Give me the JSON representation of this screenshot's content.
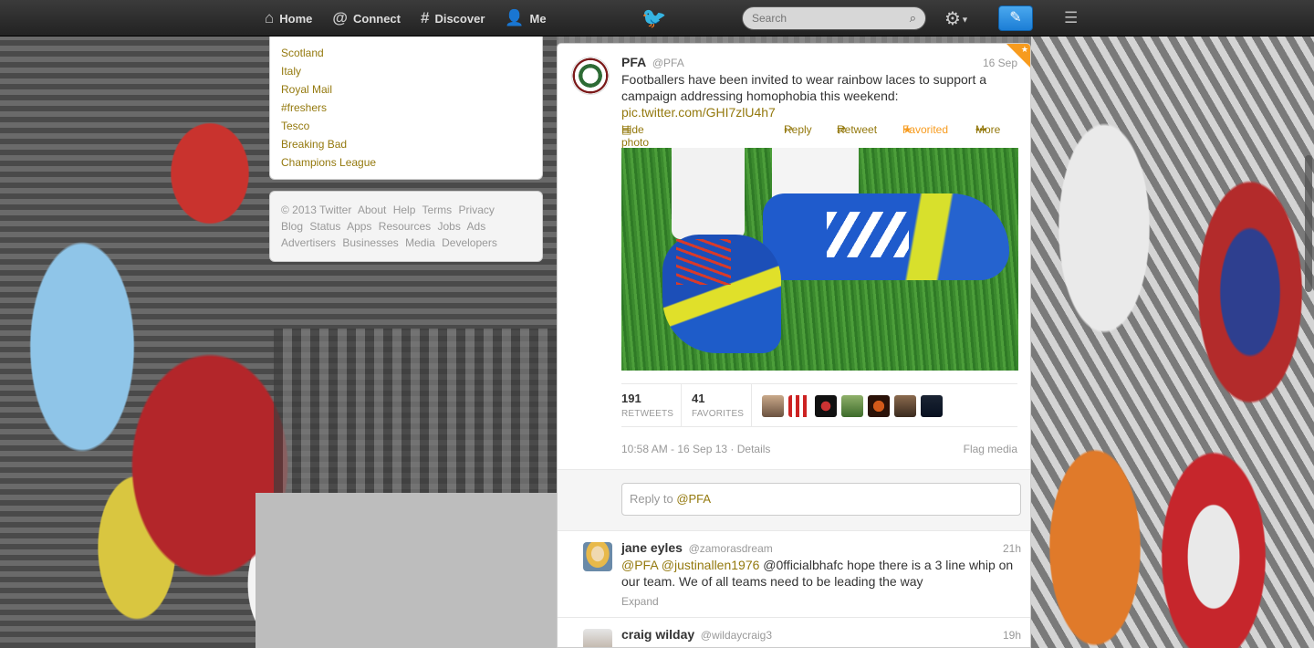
{
  "topbar": {
    "nav": [
      {
        "icon": "home-icon",
        "glyph": "⌂",
        "label": "Home"
      },
      {
        "icon": "connect-icon",
        "glyph": "@",
        "label": "Connect"
      },
      {
        "icon": "discover-icon",
        "glyph": "#",
        "label": "Discover"
      },
      {
        "icon": "me-icon",
        "glyph": "👤",
        "label": "Me"
      }
    ],
    "search_placeholder": "Search"
  },
  "trends": [
    "Scotland",
    "Italy",
    "Royal Mail",
    "#freshers",
    "Tesco",
    "Breaking Bad",
    "Champions League"
  ],
  "footer": {
    "lines": [
      [
        "© 2013 Twitter",
        "About",
        "Help",
        "Terms",
        "Privacy"
      ],
      [
        "Blog",
        "Status",
        "Apps",
        "Resources",
        "Jobs",
        "Ads"
      ],
      [
        "Advertisers",
        "Businesses",
        "Media",
        "Developers"
      ]
    ]
  },
  "tweet": {
    "name": "PFA",
    "handle": "@PFA",
    "date": "16 Sep",
    "text": "Footballers have been invited to wear rainbow laces to support a campaign addressing homophobia this weekend:",
    "link": "pic.twitter.com/GHI7zlU4h7",
    "actions": {
      "hide_photo": "Hide photo",
      "reply": "Reply",
      "retweet": "Retweet",
      "favorited": "Favorited",
      "more": "More"
    },
    "stats": {
      "retweets": "191",
      "retweets_label": "RETWEETS",
      "favorites": "41",
      "favorites_label": "FAVORITES"
    },
    "timestamp": "10:58 AM - 16 Sep 13 · Details",
    "flag": "Flag media"
  },
  "reply_box": {
    "prefix": "Reply to ",
    "handle": "@PFA"
  },
  "replies": [
    {
      "name": "jane eyles",
      "handle": "@zamorasdream",
      "time": "21h",
      "mentions": "@PFA @justinallen1976",
      "text": " @0fficialbhafc hope there is a 3 line whip on our team. We of all teams need to be leading the way",
      "expand": "Expand"
    },
    {
      "name": "craig wilday",
      "handle": "@wildaycraig3",
      "time": "19h"
    }
  ],
  "colors": {
    "link": "#94790e",
    "favorite": "#f79b1e",
    "compose": "#1c7ed6"
  }
}
